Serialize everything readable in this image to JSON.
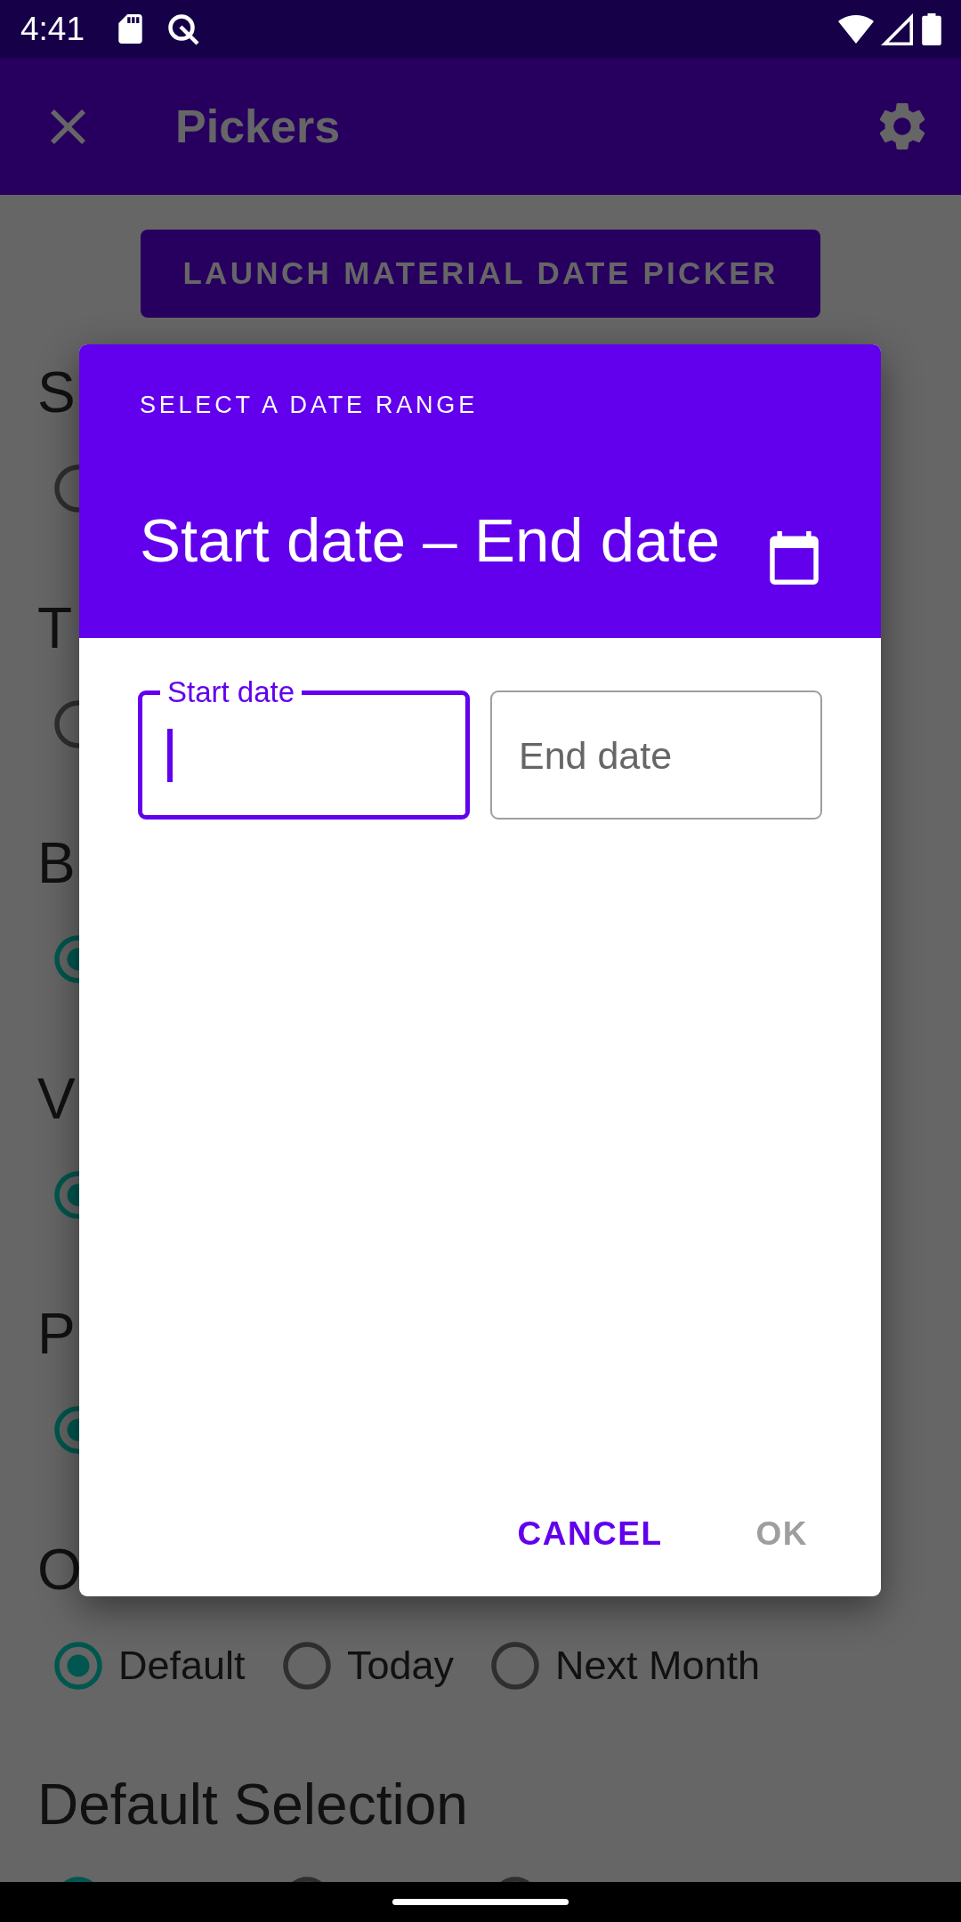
{
  "status_bar": {
    "time": "4:41"
  },
  "app_bar": {
    "title": "Pickers"
  },
  "launch_button": {
    "label": "LAUNCH MATERIAL DATE PICKER"
  },
  "sections": [
    {
      "heading": "S",
      "options": [
        {
          "kind": "covered",
          "selected": false
        }
      ]
    },
    {
      "heading": "T",
      "options": [
        {
          "kind": "covered",
          "selected": false
        }
      ]
    },
    {
      "heading": "B",
      "options": [
        {
          "kind": "covered",
          "selected": true
        }
      ]
    },
    {
      "heading": "V",
      "options": [
        {
          "kind": "covered",
          "selected": true
        }
      ]
    },
    {
      "heading": "P",
      "options": [
        {
          "kind": "covered",
          "selected": true
        }
      ]
    },
    {
      "heading": "O",
      "options": [
        {
          "kind": "full",
          "label": "Default",
          "selected": true
        },
        {
          "kind": "full",
          "label": "Today",
          "selected": false
        },
        {
          "kind": "full",
          "label": "Next Month",
          "selected": false
        }
      ]
    },
    {
      "heading": "Default Selection",
      "options": [
        {
          "kind": "cut",
          "selected": true
        },
        {
          "kind": "cut",
          "selected": false
        },
        {
          "kind": "cut",
          "selected": false
        }
      ]
    }
  ],
  "dialog": {
    "overline": "SELECT A DATE RANGE",
    "title": "Start date – End date",
    "fields": [
      {
        "label": "Start date",
        "focused": true
      },
      {
        "label": "End date",
        "focused": false
      }
    ],
    "actions": [
      {
        "label": "CANCEL",
        "disabled": false
      },
      {
        "label": "OK",
        "disabled": true
      }
    ]
  }
}
